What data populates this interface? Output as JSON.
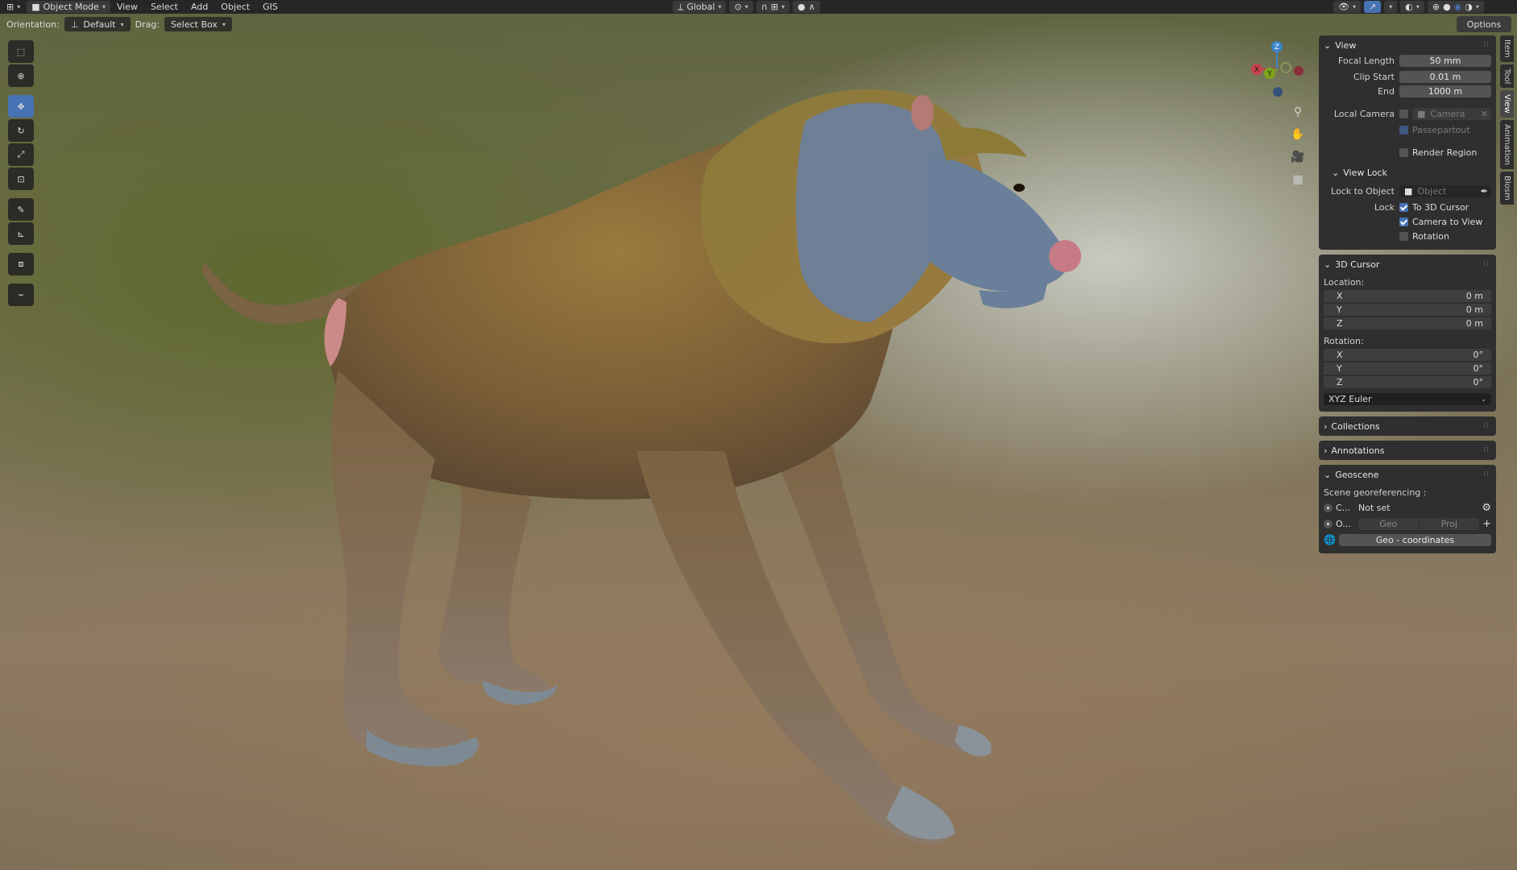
{
  "topbar": {
    "mode": "Object Mode",
    "menus": [
      "View",
      "Select",
      "Add",
      "Object",
      "GIS"
    ],
    "transform_orientation": "Global"
  },
  "header": {
    "orientation_label": "Orientation:",
    "orientation_value": "Default",
    "drag_label": "Drag:",
    "drag_value": "Select Box",
    "options_label": "Options"
  },
  "gizmo": {
    "x_label": "X",
    "y_label": "Y",
    "z_label": "Z"
  },
  "side_tabs": [
    "Item",
    "Tool",
    "View",
    "Animation",
    "Blosm"
  ],
  "view_panel": {
    "title": "View",
    "focal_length_label": "Focal Length",
    "focal_length_value": "50 mm",
    "clip_start_label": "Clip Start",
    "clip_start_value": "0.01 m",
    "end_label": "End",
    "end_value": "1000 m",
    "local_camera_label": "Local Camera",
    "camera_placeholder": "Camera",
    "passepartout_label": "Passepartout",
    "render_region_label": "Render Region",
    "view_lock_title": "View Lock",
    "lock_to_object_label": "Lock to Object",
    "object_placeholder": "Object",
    "lock_label": "Lock",
    "to_3d_cursor_label": "To 3D Cursor",
    "camera_to_view_label": "Camera to View",
    "rotation_label": "Rotation"
  },
  "cursor_panel": {
    "title": "3D Cursor",
    "location_label": "Location:",
    "location": [
      {
        "axis": "X",
        "value": "0 m"
      },
      {
        "axis": "Y",
        "value": "0 m"
      },
      {
        "axis": "Z",
        "value": "0 m"
      }
    ],
    "rotation_label": "Rotation:",
    "rotation": [
      {
        "axis": "X",
        "value": "0°"
      },
      {
        "axis": "Y",
        "value": "0°"
      },
      {
        "axis": "Z",
        "value": "0°"
      }
    ],
    "rotation_mode": "XYZ Euler"
  },
  "collections_panel": {
    "title": "Collections"
  },
  "annotations_panel": {
    "title": "Annotations"
  },
  "geoscene_panel": {
    "title": "Geoscene",
    "georef_label": "Scene georeferencing :",
    "crs_short": "C...",
    "crs_value": "Not set",
    "origin_short": "O...",
    "geo_label": "Geo",
    "proj_label": "Proj",
    "geo_coordinates_label": "Geo - coordinates"
  },
  "colors": {
    "accent": "#4772b3",
    "axis_x": "#c9424f",
    "axis_y": "#7ea31a",
    "axis_z": "#3a84c8",
    "panel_bg": "#2f2f2f",
    "field_bg": "#545454"
  }
}
